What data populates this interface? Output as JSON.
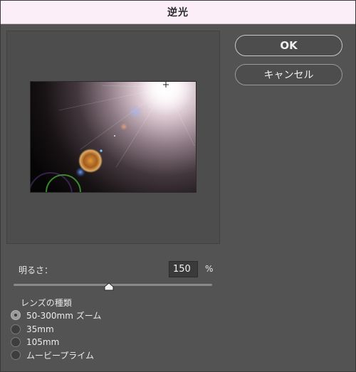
{
  "window": {
    "title": "逆光"
  },
  "buttons": {
    "ok_label": "OK",
    "cancel_label": "キャンセル"
  },
  "brightness": {
    "label": "明るさ：",
    "value": "150",
    "unit": "%",
    "slider_fraction": 0.48
  },
  "lens": {
    "group_label": "レンズの種類",
    "options": [
      {
        "label": "50-300mm ズーム",
        "selected": true
      },
      {
        "label": "35mm",
        "selected": false
      },
      {
        "label": "105mm",
        "selected": false
      },
      {
        "label": "ムービープライム",
        "selected": false
      }
    ]
  },
  "colors": {
    "title_bar": "#fbeef9",
    "dialog_bg": "#535353",
    "preview_bg": "#4d4d4d"
  },
  "icons": {
    "flare_center": "crosshair-icon",
    "slider_handle": "slider-thumb-icon"
  }
}
